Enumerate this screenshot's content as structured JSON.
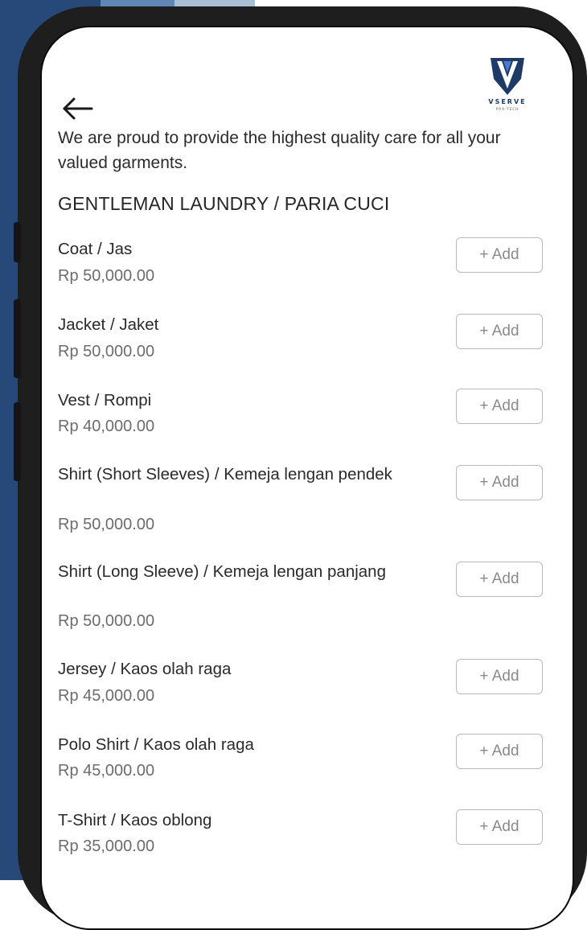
{
  "header": {
    "brand": "VSERVE",
    "brand_sub": "PRO-TECH",
    "back_icon": "arrow-left-icon"
  },
  "intro_text": "We are proud to provide the highest quality care for all your valued garments.",
  "section_title": "GENTLEMAN LAUNDRY / PARIA CUCI",
  "add_label": "+ Add",
  "items": [
    {
      "name": "Coat / Jas",
      "price": "Rp 50,000.00"
    },
    {
      "name": "Jacket / Jaket",
      "price": "Rp 50,000.00"
    },
    {
      "name": "Vest / Rompi",
      "price": "Rp 40,000.00"
    },
    {
      "name": "Shirt (Short Sleeves) / Kemeja lengan pendek",
      "price": "Rp 50,000.00"
    },
    {
      "name": "Shirt (Long Sleeve) / Kemeja lengan panjang",
      "price": "Rp 50,000.00"
    },
    {
      "name": "Jersey / Kaos olah raga",
      "price": "Rp 45,000.00"
    },
    {
      "name": "Polo Shirt / Kaos olah raga",
      "price": "Rp 45,000.00"
    },
    {
      "name": "T-Shirt / Kaos oblong",
      "price": "Rp 35,000.00"
    }
  ],
  "colors": {
    "brand_navy": "#1f3a66",
    "background_blue": "#27497a"
  }
}
